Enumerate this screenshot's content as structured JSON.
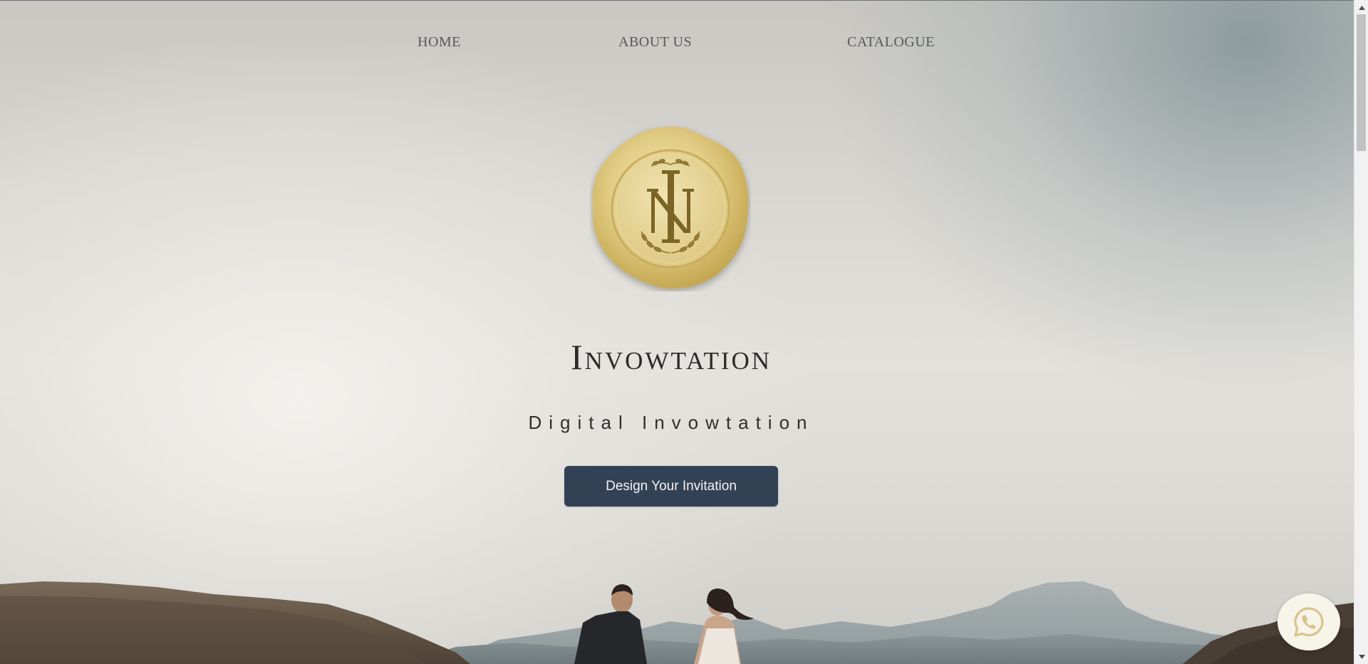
{
  "nav": {
    "home_label": "HOME",
    "about_label": "ABOUT US",
    "catalogue_label": "CATALOGUE"
  },
  "hero": {
    "seal_monogram": "NI",
    "title": "Invowtation",
    "subtitle": "Digital Invowtation",
    "cta_label": "Design Your Invitation"
  },
  "floating": {
    "icon": "whatsapp-icon"
  },
  "colors": {
    "cta_background": "#334155",
    "seal_gold": "#d9c27a",
    "nav_text": "#555a5c"
  }
}
